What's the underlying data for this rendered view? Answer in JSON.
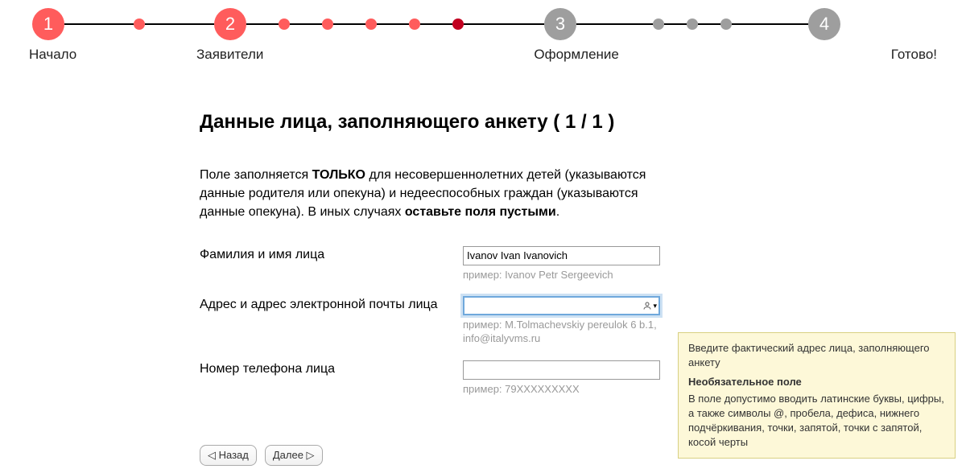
{
  "stepper": {
    "steps": [
      {
        "num": "1",
        "label": "Начало"
      },
      {
        "num": "2",
        "label": "Заявители"
      },
      {
        "num": "3",
        "label": "Оформление"
      },
      {
        "num": "4",
        "label": "Готово!"
      }
    ]
  },
  "page": {
    "title": "Данные лица, заполняющего анкету ( 1 / 1 )",
    "desc_pre": "Поле заполняется ",
    "desc_only": "ТОЛЬКО",
    "desc_mid": " для несовершеннолетних детей (указываются данные родителя или опекуна) и недееспособных граждан (указываются данные опекуна). В иных случаях ",
    "desc_leave": "оставьте поля пустыми",
    "desc_end": "."
  },
  "form": {
    "name": {
      "label": "Фамилия и имя лица",
      "value": "Ivanov Ivan Ivanovich",
      "hint": "пример: Ivanov Petr Sergeevich"
    },
    "address": {
      "label": "Адрес и адрес электронной почты лица",
      "value": "",
      "hint": "пример: M.Tolmachevskiy pereulok 6 b.1, info@italyvms.ru"
    },
    "phone": {
      "label": "Номер телефона лица",
      "value": "",
      "hint": "пример: 79XXXXXXXXX"
    }
  },
  "tooltip": {
    "line1": "Введите фактический адрес лица, заполняющего анкету",
    "title": "Необязательное поле",
    "body": "В поле допустимо вводить латинские буквы, цифры, а также символы @, пробела, дефиса, нижнего подчёркивания, точки, запятой, точки с запятой, косой черты"
  },
  "nav": {
    "back": "◁ Назад",
    "next": "Далее ▷"
  }
}
